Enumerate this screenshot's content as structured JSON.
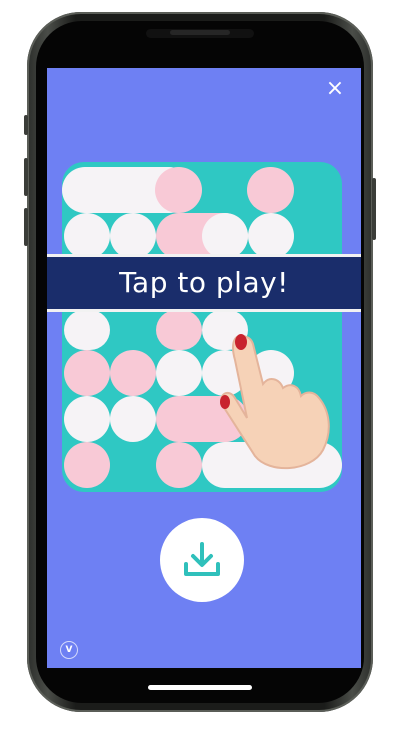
{
  "ad": {
    "banner_text": "Tap to play!",
    "close_icon": "close-icon",
    "download_icon": "download-icon",
    "brand_logo_text": "V"
  },
  "colors": {
    "screen_background": "#6e80f3",
    "board_background": "#2fc8c3",
    "banner_background": "#1a2d6b",
    "tile_white": "#f6f3f6",
    "tile_pink": "#f8c9d6"
  }
}
